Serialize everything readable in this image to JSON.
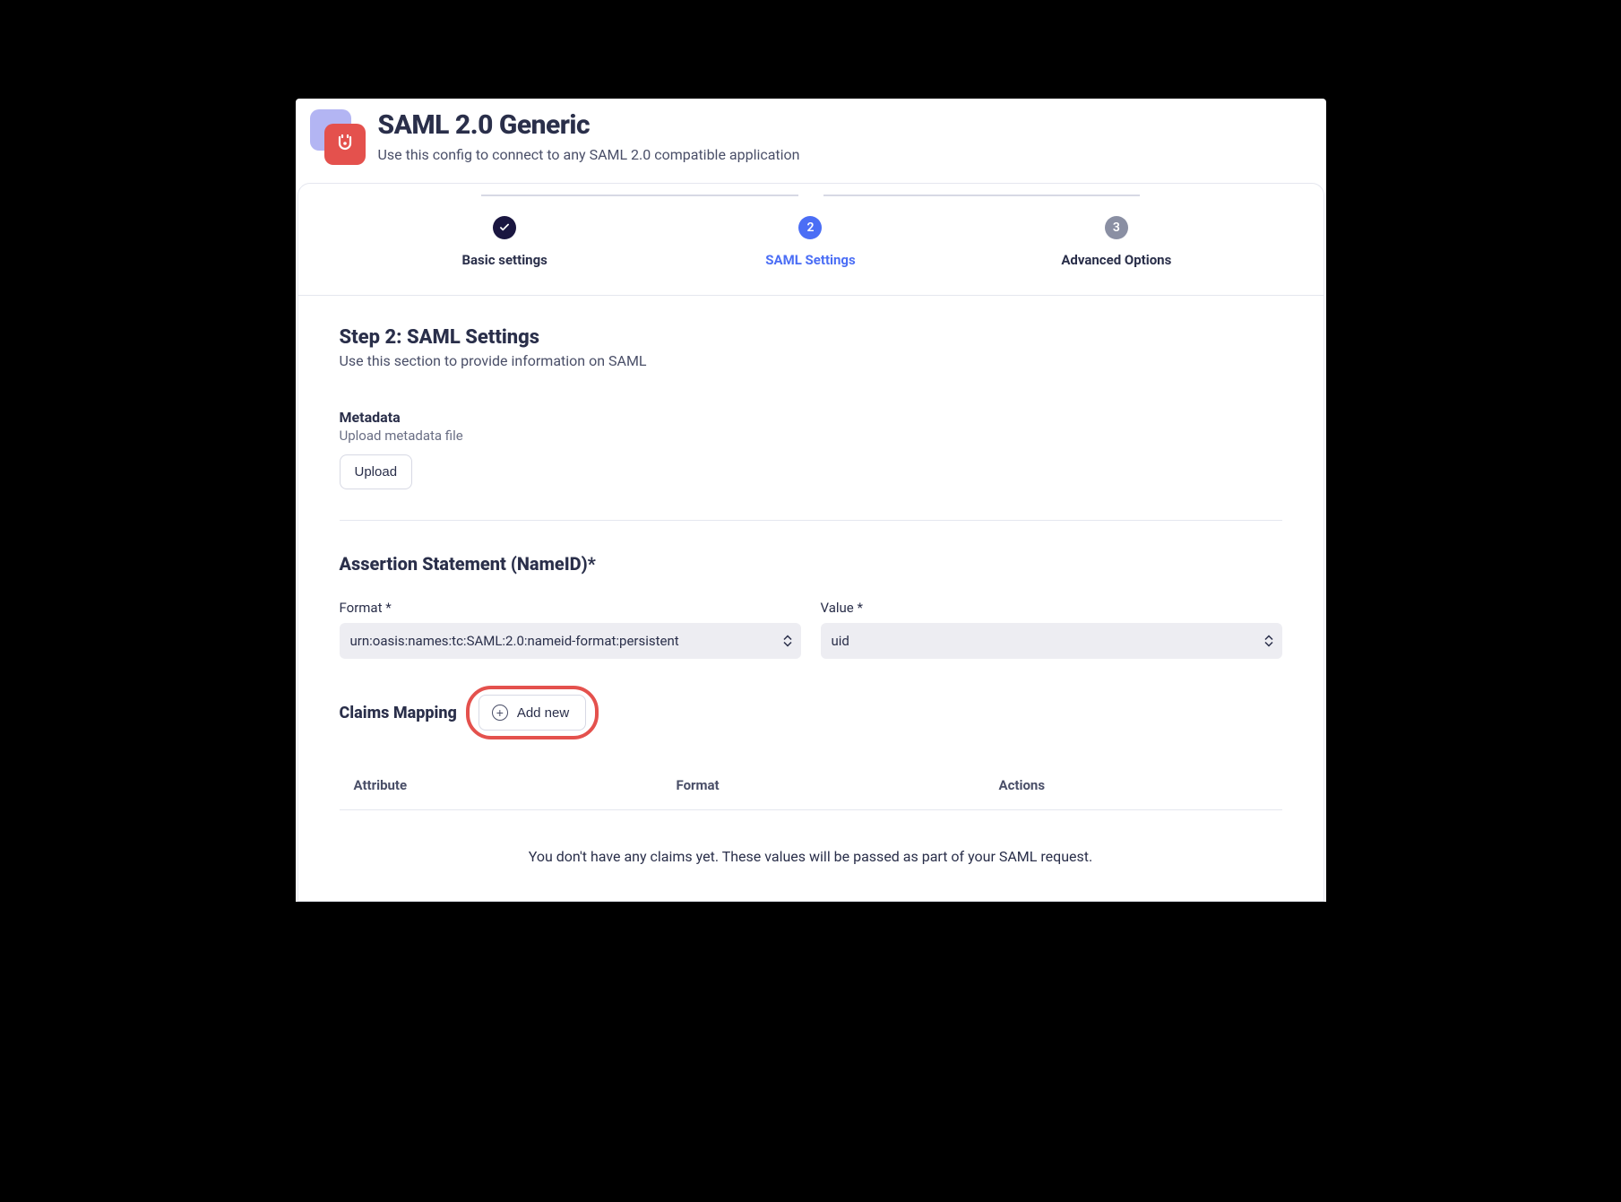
{
  "header": {
    "title": "SAML 2.0 Generic",
    "subtitle": "Use this config to connect to any SAML 2.0 compatible application"
  },
  "stepper": {
    "steps": [
      {
        "label": "Basic settings",
        "marker": "✓",
        "state": "done"
      },
      {
        "label": "SAML Settings",
        "marker": "2",
        "state": "active"
      },
      {
        "label": "Advanced Options",
        "marker": "3",
        "state": "todo"
      }
    ]
  },
  "step_heading": {
    "title": "Step 2: SAML Settings",
    "subtitle": "Use this section to provide information on SAML"
  },
  "metadata": {
    "title": "Metadata",
    "subtitle": "Upload metadata file",
    "upload_label": "Upload"
  },
  "assertion": {
    "title": "Assertion Statement (NameID)*",
    "format_label": "Format *",
    "format_value": "urn:oasis:names:tc:SAML:2.0:nameid-format:persistent",
    "value_label": "Value *",
    "value_value": "uid"
  },
  "claims": {
    "title": "Claims Mapping",
    "add_label": "Add new",
    "columns": {
      "attribute": "Attribute",
      "format": "Format",
      "actions": "Actions"
    },
    "empty": "You don't have any claims yet. These values will be passed as part of your SAML request."
  }
}
